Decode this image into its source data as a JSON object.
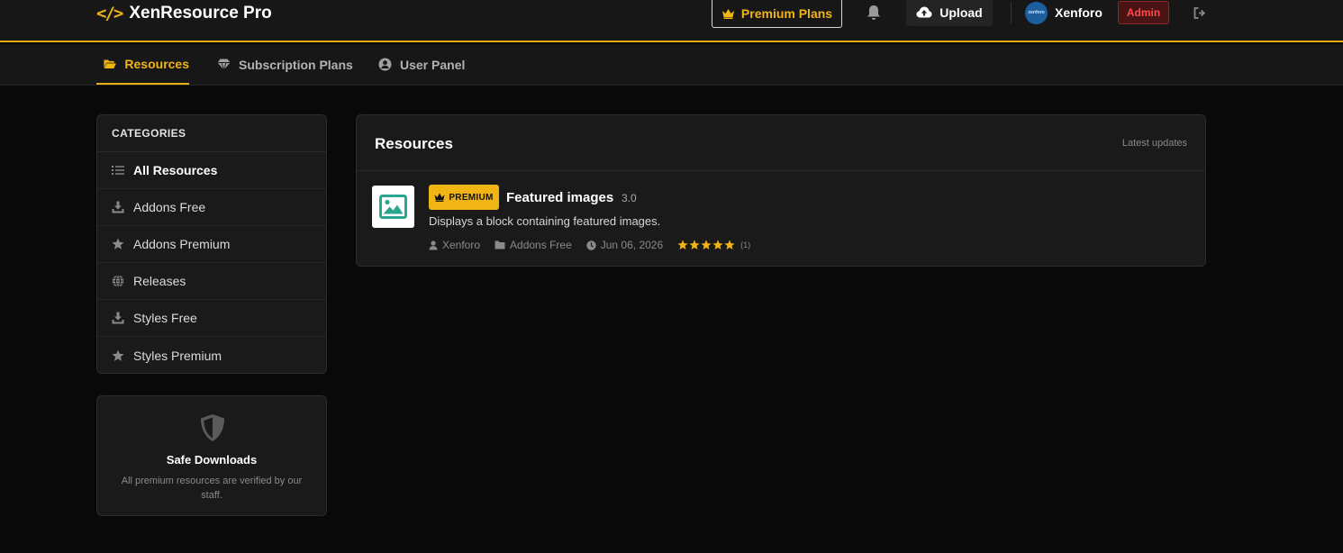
{
  "header": {
    "logo_symbol": "</>",
    "logo_text": "XenResource Pro",
    "premium_label": "Premium Plans",
    "upload_label": "Upload",
    "avatar_text": "xenforo",
    "user_name": "Xenforo",
    "admin_label": "Admin",
    "icons": [
      "crown-icon",
      "bell-icon",
      "cloud-upload-icon",
      "logout-icon"
    ]
  },
  "nav": {
    "tabs": [
      {
        "label": "Resources",
        "icon": "folder-open-icon",
        "active": true
      },
      {
        "label": "Subscription Plans",
        "icon": "gem-icon",
        "active": false
      },
      {
        "label": "User Panel",
        "icon": "user-circle-icon",
        "active": false
      }
    ]
  },
  "sidebar": {
    "title": "CATEGORIES",
    "items": [
      {
        "label": "All Resources",
        "icon": "list-icon",
        "active": true
      },
      {
        "label": "Addons Free",
        "icon": "download-icon",
        "active": false
      },
      {
        "label": "Addons Premium",
        "icon": "star-icon",
        "active": false
      },
      {
        "label": "Releases",
        "icon": "globe-icon",
        "active": false
      },
      {
        "label": "Styles Free",
        "icon": "download-icon",
        "active": false
      },
      {
        "label": "Styles Premium",
        "icon": "star-icon",
        "active": false
      }
    ],
    "safe": {
      "title": "Safe Downloads",
      "desc": "All premium resources are verified by our staff.",
      "icon": "shield-icon"
    }
  },
  "main": {
    "title": "Resources",
    "subtitle": "Latest updates",
    "resources": [
      {
        "badge": "PREMIUM",
        "title": "Featured images",
        "version": "3.0",
        "description": "Displays a block containing featured images.",
        "author": "Xenforo",
        "category": "Addons Free",
        "date": "Jun 06, 2026",
        "rating": 5,
        "rating_count": "(1)",
        "thumb_icon": "image-icon"
      }
    ]
  },
  "colors": {
    "accent": "#f0b514",
    "background": "#09090a",
    "panel": "#1a1a1b",
    "admin_text": "#ff4a4a"
  }
}
